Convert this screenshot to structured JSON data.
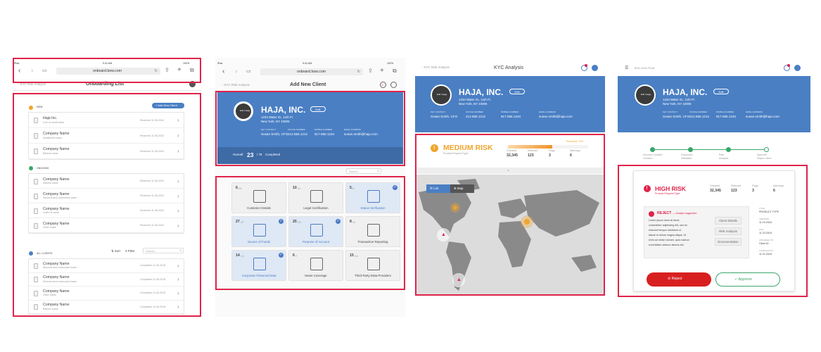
{
  "ipad_status": {
    "device": "iPad",
    "time": "9:41 AM",
    "battery": "100%"
  },
  "browser": {
    "url": "onboard.bow.com"
  },
  "screen1": {
    "back": "KYC Risk Analysis",
    "title": "Onboarding List",
    "add_button": "+ Add New Client",
    "sections": [
      {
        "label": "NEW",
        "rows": [
          {
            "name": "Haja Inc.",
            "sub": "Line of credit loans",
            "status": "Received 11.06.2018"
          },
          {
            "name": "Company Name",
            "sub": "Installment loans",
            "status": "Received 11.06.2018"
          },
          {
            "name": "Company Name",
            "sub": "Balloon loans",
            "status": "Received 11.06.2018"
          }
        ]
      },
      {
        "label": "ONGOING",
        "rows": [
          {
            "name": "Company Name",
            "sub": "Interest loans",
            "status": "Received 11.06.2018"
          },
          {
            "name": "Company Name",
            "sub": "Secured and unsecured loans",
            "status": "Received 11.06.2018"
          },
          {
            "name": "Company Name",
            "sub": "Letter of credit",
            "status": "Received 11.06.2018"
          },
          {
            "name": "Company Name",
            "sub": "Other loans",
            "status": "Received 11.06.2018"
          }
        ]
      },
      {
        "label": "ALL CLIENTS",
        "rows": [
          {
            "name": "Company Name",
            "sub": "Secured and unsecured loans",
            "status": "Completed 11.26.2018"
          },
          {
            "name": "Company Name",
            "sub": "Secured and unsecured loans",
            "status": "Completed 11.26.2018"
          },
          {
            "name": "Company Name",
            "sub": "Other loans",
            "status": "Completed 11.26.2018"
          },
          {
            "name": "Company Name",
            "sub": "Balloon loans",
            "status": "Completed 11.26.2018"
          }
        ]
      }
    ],
    "sort": "Sort",
    "filter": "Filter",
    "search": "Search..."
  },
  "screen2": {
    "back": "KYC Risk Analysis",
    "title": "Add New Client",
    "badge_count": "2",
    "company": "HAJA, INC.",
    "edit": "Edit",
    "address1": "1234 Water St., 11th Fl.",
    "address2": "New York, NY 10005",
    "contacts": [
      {
        "label": "KEY CONTACT",
        "value": "Susan Smith, CFO"
      },
      {
        "label": "OFFICE NUMBER",
        "value": "212.555.1212"
      },
      {
        "label": "MOBILE NUMBER",
        "value": "917.555.1234"
      },
      {
        "label": "EMAIL ADDRESS",
        "value": "susan.smith@haja.com"
      }
    ],
    "avatar_text": "Edit Image",
    "overall_label": "Overall:",
    "overall_value": "23",
    "overall_total": "/ 78",
    "overall_suffix": "Completed",
    "search": "Search",
    "tiles": [
      {
        "count": "6",
        "total": "/16",
        "label": "Customer Details",
        "selected": false
      },
      {
        "count": "10",
        "total": "/11",
        "label": "Legal Certification",
        "selected": false
      },
      {
        "count": "5",
        "total": "/5",
        "label": "Status Verification",
        "selected": true
      },
      {
        "count": "27",
        "total": "/27",
        "label": "Source of Funds",
        "selected": true
      },
      {
        "count": "25",
        "total": "/25",
        "label": "Purpose of Account",
        "selected": true
      },
      {
        "count": "8",
        "total": "/12",
        "label": "Transaction Reporting",
        "selected": false
      },
      {
        "count": "14",
        "total": "/14",
        "label": "Corporate Financial Data",
        "selected": true
      },
      {
        "count": "6",
        "total": "/7",
        "label": "News Coverage",
        "selected": false
      },
      {
        "count": "15",
        "total": "/16",
        "label": "Third-Party Data Providers",
        "selected": false
      }
    ]
  },
  "screen3": {
    "back": "KYC Risk Analysis",
    "title": "KYC Analysis",
    "company": "HAJA, INC.",
    "edit": "Edit",
    "address1": "1234 Water St., 11th Fl.",
    "address2": "New York, NY 10005",
    "contacts": [
      {
        "label": "KEY CONTACT",
        "value": "Susan Smith, CFO"
      },
      {
        "label": "OFFICE NUMBER",
        "value": "212.555.1212"
      },
      {
        "label": "MOBILE NUMBER",
        "value": "917.555.1234"
      },
      {
        "label": "EMAIL ADDRESS",
        "value": "susan.smith@haja.com"
      }
    ],
    "avatar_text": "Edit Image",
    "risk_title": "MEDIUM RISK",
    "risk_sub": "Product Request Type",
    "threshold": "Threshold: 70%",
    "stats": [
      {
        "label": "Checked",
        "value": "32,345"
      },
      {
        "label": "Relevant",
        "value": "123"
      },
      {
        "label": "Flags",
        "value": "3"
      },
      {
        "label": "Warnings",
        "value": "6"
      }
    ],
    "risk_level": 0.55,
    "toggle_list": "List",
    "toggle_map": "Map"
  },
  "screen4": {
    "menu": "BoW Client Portal",
    "company": "HAJA, INC.",
    "edit": "Edit",
    "address1": "1234 Water St., 11th Fl.",
    "address2": "New York, NY 10005",
    "contacts": [
      {
        "label": "KEY CONTACT",
        "value": "Susan Smith, CFO"
      },
      {
        "label": "OFFICE NUMBER",
        "value": "212.555.1212"
      },
      {
        "label": "MOBILE NUMBER",
        "value": "917.555.1234"
      },
      {
        "label": "EMAIL ADDRESS",
        "value": "susan.smith@haja.com"
      }
    ],
    "avatar_text": "Edit Image",
    "steps": [
      {
        "label": "Account Creation",
        "l2": "Creation"
      },
      {
        "label": "Document",
        "l2": "Validation"
      },
      {
        "label": "Risk",
        "l2": "Analysis"
      },
      {
        "label": "Approve/",
        "l2": "Reject Client"
      }
    ],
    "risk_title": "HIGH RISK",
    "risk_sub": "Product Request Type",
    "stats": [
      {
        "label": "Checked",
        "value": "32,345"
      },
      {
        "label": "Relevant",
        "value": "123"
      },
      {
        "label": "Flags",
        "value": "3"
      },
      {
        "label": "Warnings",
        "value": "6"
      }
    ],
    "reject_title": "REJECT",
    "reject_note": "— Analyst suggestion",
    "lorem": [
      "Lorem ipsum dolor sit amet,",
      "consectetur adipisicing elit, sed do",
      "eiusmod tempor incididunt ut",
      "labore et dolore magna aliqua. Ut",
      "enim ad minim veniam, quis nostrud",
      "exercitation ullamco laboris nisi"
    ],
    "buttons": [
      "Client Details",
      "Risk Analysis",
      "Documentation"
    ],
    "meta": [
      {
        "k": "TYPE",
        "v": "PRODUCT TYPE"
      },
      {
        "k": "CREATED",
        "v": "11.19.2018"
      },
      {
        "k": "DUE",
        "v": "11.23.2018"
      },
      {
        "k": "ASSIGNED TO",
        "v": "Client ID"
      },
      {
        "k": "COMPLETION",
        "v": "11.21.2018"
      }
    ],
    "reject_btn": "Reject",
    "approve_btn": "Approve"
  }
}
